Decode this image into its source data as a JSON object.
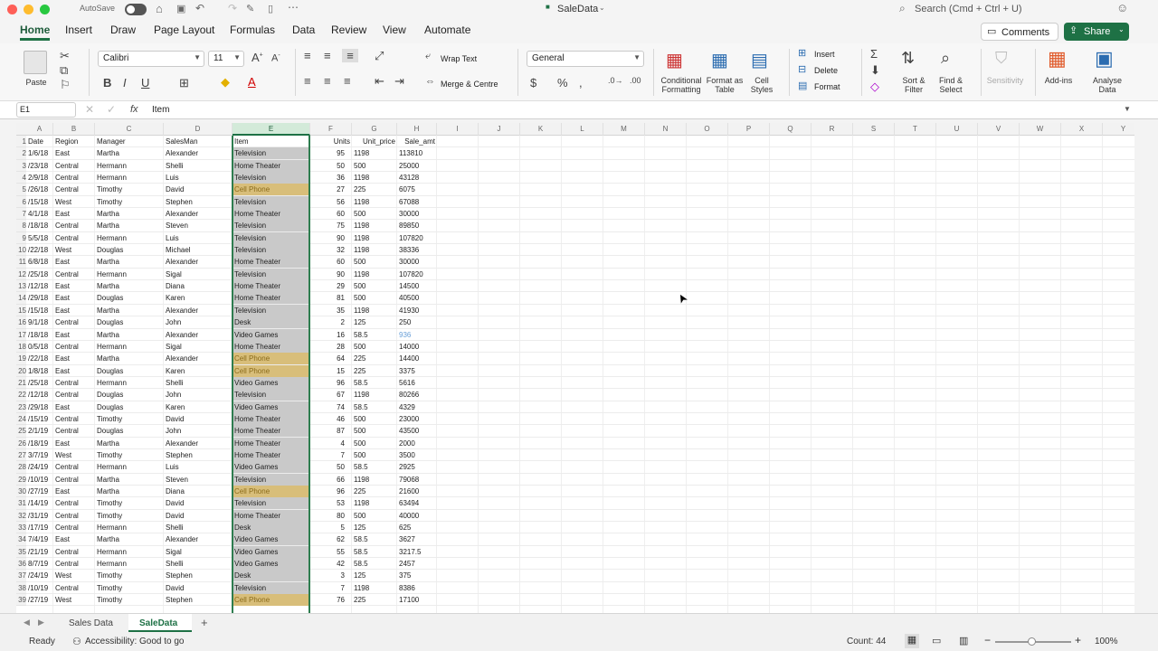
{
  "titlebar": {
    "autosave": "AutoSave",
    "doc_title": "SaleData",
    "search": "Search (Cmd + Ctrl + U)"
  },
  "ribbon_tabs": [
    "Home",
    "Insert",
    "Draw",
    "Page Layout",
    "Formulas",
    "Data",
    "Review",
    "View",
    "Automate"
  ],
  "actions": {
    "comments": "Comments",
    "share": "Share"
  },
  "ribbon": {
    "paste": "Paste",
    "font_name": "Calibri",
    "font_size": "11",
    "bold": "B",
    "italic": "I",
    "underline": "U",
    "wrap_text": "Wrap Text",
    "merge_centre": "Merge & Centre",
    "number_format": "General",
    "conditional": "Conditional Formatting",
    "format_table": "Format as Table",
    "cell_styles": "Cell Styles",
    "insert": "Insert",
    "delete": "Delete",
    "format": "Format",
    "sort_filter": "Sort & Filter",
    "find_select": "Find & Select",
    "sensitivity": "Sensitivity",
    "addins": "Add-ins",
    "analyse": "Analyse Data"
  },
  "formula_bar": {
    "name_box": "E1",
    "fx": "fx",
    "content": "Item"
  },
  "columns": [
    "A",
    "B",
    "C",
    "D",
    "E",
    "F",
    "G",
    "H",
    "I",
    "J",
    "K",
    "L",
    "M",
    "N",
    "O",
    "P",
    "Q",
    "R",
    "S",
    "T",
    "U",
    "V",
    "W",
    "X",
    "Y"
  ],
  "selected_column": "E",
  "headers": [
    "Date",
    "Region",
    "Manager",
    "SalesMan",
    "Item",
    "Units",
    "Unit_price",
    "Sale_amt"
  ],
  "rows": [
    [
      "1/6/18",
      "East",
      "Martha",
      "Alexander",
      "Television",
      "95",
      "1198",
      "113810"
    ],
    [
      "/23/18",
      "Central",
      "Hermann",
      "Shelli",
      "Home Theater",
      "50",
      "500",
      "25000"
    ],
    [
      "2/9/18",
      "Central",
      "Hermann",
      "Luis",
      "Television",
      "36",
      "1198",
      "43128"
    ],
    [
      "/26/18",
      "Central",
      "Timothy",
      "David",
      "Cell Phone",
      "27",
      "225",
      "6075"
    ],
    [
      "/15/18",
      "West",
      "Timothy",
      "Stephen",
      "Television",
      "56",
      "1198",
      "67088"
    ],
    [
      "4/1/18",
      "East",
      "Martha",
      "Alexander",
      "Home Theater",
      "60",
      "500",
      "30000"
    ],
    [
      "/18/18",
      "Central",
      "Martha",
      "Steven",
      "Television",
      "75",
      "1198",
      "89850"
    ],
    [
      "5/5/18",
      "Central",
      "Hermann",
      "Luis",
      "Television",
      "90",
      "1198",
      "107820"
    ],
    [
      "/22/18",
      "West",
      "Douglas",
      "Michael",
      "Television",
      "32",
      "1198",
      "38336"
    ],
    [
      "6/8/18",
      "East",
      "Martha",
      "Alexander",
      "Home Theater",
      "60",
      "500",
      "30000"
    ],
    [
      "/25/18",
      "Central",
      "Hermann",
      "Sigal",
      "Television",
      "90",
      "1198",
      "107820"
    ],
    [
      "/12/18",
      "East",
      "Martha",
      "Diana",
      "Home Theater",
      "29",
      "500",
      "14500"
    ],
    [
      "/29/18",
      "East",
      "Douglas",
      "Karen",
      "Home Theater",
      "81",
      "500",
      "40500"
    ],
    [
      "/15/18",
      "East",
      "Martha",
      "Alexander",
      "Television",
      "35",
      "1198",
      "41930"
    ],
    [
      "9/1/18",
      "Central",
      "Douglas",
      "John",
      "Desk",
      "2",
      "125",
      "250"
    ],
    [
      "/18/18",
      "East",
      "Martha",
      "Alexander",
      "Video Games",
      "16",
      "58.5",
      "936"
    ],
    [
      "0/5/18",
      "Central",
      "Hermann",
      "Sigal",
      "Home Theater",
      "28",
      "500",
      "14000"
    ],
    [
      "/22/18",
      "East",
      "Martha",
      "Alexander",
      "Cell Phone",
      "64",
      "225",
      "14400"
    ],
    [
      "1/8/18",
      "East",
      "Douglas",
      "Karen",
      "Cell Phone",
      "15",
      "225",
      "3375"
    ],
    [
      "/25/18",
      "Central",
      "Hermann",
      "Shelli",
      "Video Games",
      "96",
      "58.5",
      "5616"
    ],
    [
      "/12/18",
      "Central",
      "Douglas",
      "John",
      "Television",
      "67",
      "1198",
      "80266"
    ],
    [
      "/29/18",
      "East",
      "Douglas",
      "Karen",
      "Video Games",
      "74",
      "58.5",
      "4329"
    ],
    [
      "/15/19",
      "Central",
      "Timothy",
      "David",
      "Home Theater",
      "46",
      "500",
      "23000"
    ],
    [
      "2/1/19",
      "Central",
      "Douglas",
      "John",
      "Home Theater",
      "87",
      "500",
      "43500"
    ],
    [
      "/18/19",
      "East",
      "Martha",
      "Alexander",
      "Home Theater",
      "4",
      "500",
      "2000"
    ],
    [
      "3/7/19",
      "West",
      "Timothy",
      "Stephen",
      "Home Theater",
      "7",
      "500",
      "3500"
    ],
    [
      "/24/19",
      "Central",
      "Hermann",
      "Luis",
      "Video Games",
      "50",
      "58.5",
      "2925"
    ],
    [
      "/10/19",
      "Central",
      "Martha",
      "Steven",
      "Television",
      "66",
      "1198",
      "79068"
    ],
    [
      "/27/19",
      "East",
      "Martha",
      "Diana",
      "Cell Phone",
      "96",
      "225",
      "21600"
    ],
    [
      "/14/19",
      "Central",
      "Timothy",
      "David",
      "Television",
      "53",
      "1198",
      "63494"
    ],
    [
      "/31/19",
      "Central",
      "Timothy",
      "David",
      "Home Theater",
      "80",
      "500",
      "40000"
    ],
    [
      "/17/19",
      "Central",
      "Hermann",
      "Shelli",
      "Desk",
      "5",
      "125",
      "625"
    ],
    [
      "7/4/19",
      "East",
      "Martha",
      "Alexander",
      "Video Games",
      "62",
      "58.5",
      "3627"
    ],
    [
      "/21/19",
      "Central",
      "Hermann",
      "Sigal",
      "Video Games",
      "55",
      "58.5",
      "3217.5"
    ],
    [
      "8/7/19",
      "Central",
      "Hermann",
      "Shelli",
      "Video Games",
      "42",
      "58.5",
      "2457"
    ],
    [
      "/24/19",
      "West",
      "Timothy",
      "Stephen",
      "Desk",
      "3",
      "125",
      "375"
    ],
    [
      "/10/19",
      "Central",
      "Timothy",
      "David",
      "Television",
      "7",
      "1198",
      "8386"
    ],
    [
      "/27/19",
      "West",
      "Timothy",
      "Stephen",
      "Cell Phone",
      "76",
      "225",
      "17100"
    ]
  ],
  "sheet_tabs": [
    "Sales Data",
    "SaleData"
  ],
  "active_sheet": "SaleData",
  "status": {
    "ready": "Ready",
    "accessibility": "Accessibility: Good to go",
    "count": "Count: 44",
    "zoom": "100%"
  }
}
